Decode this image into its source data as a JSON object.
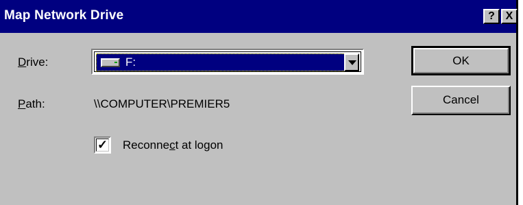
{
  "window": {
    "title": "Map Network Drive",
    "help_button": "?",
    "close_button": "X"
  },
  "drive": {
    "label_accel": "D",
    "label_rest": "rive:",
    "selected_value": "F:",
    "icon": "network-drive-icon"
  },
  "path": {
    "label_accel": "P",
    "label_rest": "ath:",
    "value": "\\\\COMPUTER\\PREMIER5"
  },
  "reconnect": {
    "label_pre": "Reconne",
    "label_accel": "c",
    "label_post": "t at logon",
    "checked": true,
    "check_glyph": "✓"
  },
  "buttons": {
    "ok": "OK",
    "cancel": "Cancel"
  },
  "colors": {
    "titlebar": "#000080",
    "dialog_face": "#c0c0c0",
    "selection": "#000080"
  }
}
